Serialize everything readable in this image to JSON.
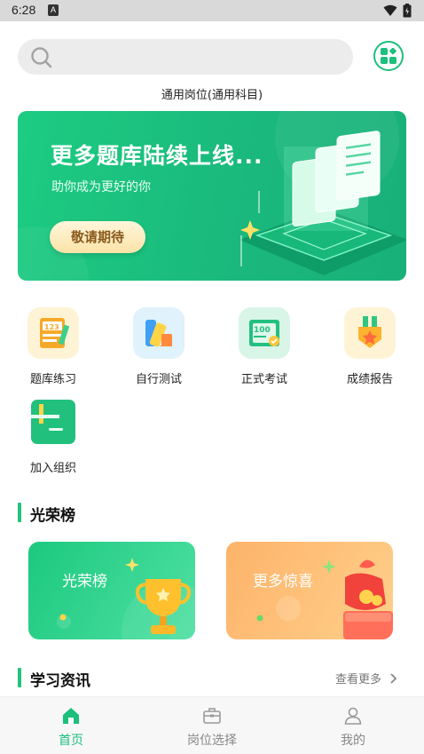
{
  "status_bar": {
    "time": "6:28",
    "notification_glyph": "A"
  },
  "search": {
    "placeholder": ""
  },
  "subject_selector": {
    "label": "通用岗位(通用科目)"
  },
  "banner": {
    "title": "更多题库陆续上线...",
    "subtitle": "助你成为更好的你",
    "button_label": "敬请期待"
  },
  "features": [
    {
      "label": "题库练习",
      "icon": "question-bank-icon"
    },
    {
      "label": "自行测试",
      "icon": "self-test-icon"
    },
    {
      "label": "正式考试",
      "icon": "formal-exam-icon"
    },
    {
      "label": "成绩报告",
      "icon": "score-report-icon"
    },
    {
      "label": "加入组织",
      "icon": "join-organization-icon"
    }
  ],
  "honor_section": {
    "title": "光荣榜",
    "cards": [
      {
        "label": "光荣榜",
        "icon": "trophy-icon"
      },
      {
        "label": "更多惊喜",
        "icon": "gift-icon"
      }
    ]
  },
  "news_section": {
    "title": "学习资讯",
    "more_label": "查看更多"
  },
  "tab_bar": {
    "tabs": [
      {
        "label": "首页",
        "icon": "home-icon",
        "active": true
      },
      {
        "label": "岗位选择",
        "icon": "briefcase-icon",
        "active": false
      },
      {
        "label": "我的",
        "icon": "profile-icon",
        "active": false
      }
    ]
  },
  "colors": {
    "accent": "#1cbf7c",
    "banner_green": "#1dcc82",
    "honor_green": "#1cc97e",
    "surprise_orange": "#fdb36a",
    "tab_active": "#1cbf7c",
    "tab_inactive": "#888888"
  }
}
